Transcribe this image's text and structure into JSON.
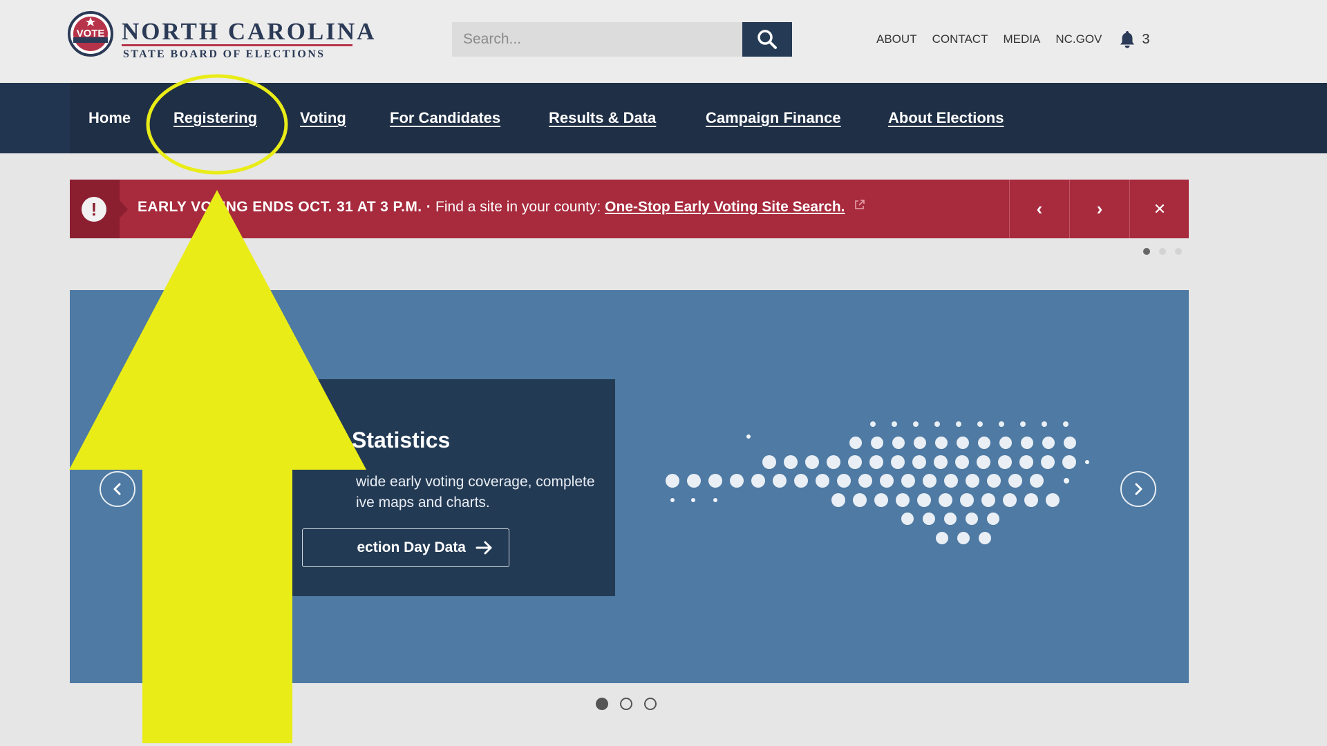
{
  "header": {
    "logo": {
      "seal_text": "VOTE",
      "title": "NORTH CAROLINA",
      "subtitle": "STATE BOARD OF ELECTIONS"
    },
    "search": {
      "placeholder": "Search...",
      "icon": "search-icon"
    },
    "utility_links": [
      "ABOUT",
      "CONTACT",
      "MEDIA",
      "NC.GOV"
    ],
    "notifications": {
      "icon": "bell-icon",
      "count": "3"
    }
  },
  "nav": {
    "items": [
      "Home",
      "Registering",
      "Voting",
      "For Candidates",
      "Results & Data",
      "Campaign Finance",
      "About Elections"
    ]
  },
  "alert": {
    "icon": "exclamation-icon",
    "icon_glyph": "!",
    "headline": "EARLY VOTING ENDS OCT. 31 AT 3 P.M. ·",
    "prompt": "Find a site in your county:",
    "link": "One-Stop Early Voting Site Search.",
    "prev_glyph": "‹",
    "next_glyph": "›",
    "close_glyph": "✕",
    "dots": {
      "count": 3,
      "active": 0
    }
  },
  "hero": {
    "title": "Statistics",
    "description": "wide early voting coverage, complete ive maps and charts.",
    "cta_label": "ection Day Data",
    "dots": {
      "count": 3,
      "active": 0
    }
  },
  "colors": {
    "nav_bg": "#1f2f46",
    "alert_bg": "#a72a3d",
    "hero_bg": "#4e7aa3",
    "card_bg": "#233a54",
    "annotation": "#e9ec17"
  }
}
